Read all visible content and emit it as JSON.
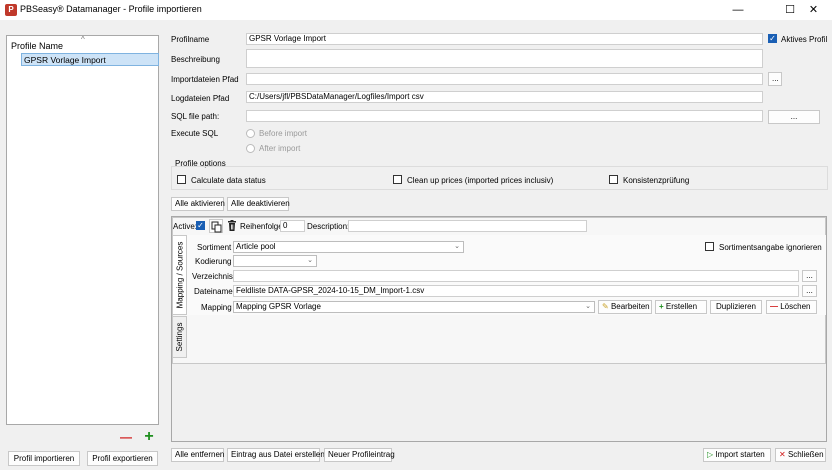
{
  "window": {
    "title": "PBSeasy® Datamanager - Profile importieren",
    "minimize": "—",
    "maximize": "☐",
    "close": "✕"
  },
  "sidebar": {
    "header": "Profile Name",
    "sort_indicator": "^",
    "items": [
      "GPSR Vorlage Import"
    ],
    "remove_symbol": "—",
    "add_symbol": "+"
  },
  "form": {
    "profilname_label": "Profilname",
    "profilname_value": "GPSR Vorlage Import",
    "aktives_profil_label": "Aktives Profil",
    "beschreibung_label": "Beschreibung",
    "beschreibung_value": "",
    "importdateien_label": "Importdateien Pfad",
    "importdateien_value": "",
    "logdateien_label": "Logdateien Pfad",
    "logdateien_value": "C:/Users/jfl/PBSDataManager/Logfiles/Import csv",
    "sql_label": "SQL file path:",
    "sql_value": "",
    "browse_label": "...",
    "execute_sql_label": "Execute SQL",
    "before_import": "Before import",
    "after_import": "After import"
  },
  "profile_options": {
    "title": "Profile options",
    "calculate": "Calculate data status",
    "cleanup": "Clean up prices (imported prices inclusiv)",
    "konsistenz": "Konsistenzprüfung"
  },
  "activate_buttons": {
    "all_on": "Alle aktivieren",
    "all_off": "Alle deaktivieren"
  },
  "entry": {
    "active_label": "Active:",
    "reihenfolge_label": "Reihenfolge",
    "reihenfolge_value": "0",
    "description_label": "Description:",
    "description_value": "",
    "tab_mapping": "Mapping / Sources",
    "tab_settings": "Settings",
    "sortiment_label": "Sortiment",
    "sortiment_value": "Article pool",
    "sortiment_ignore": "Sortimentsangabe ignorieren",
    "kodierung_label": "Kodierung",
    "kodierung_value": "",
    "verzeichnis_label": "Verzeichnis",
    "verzeichnis_value": "",
    "dateiname_label": "Dateiname",
    "dateiname_value": "Feldliste DATA-GPSR_2024-10-15_DM_Import-1.csv",
    "mapping_label": "Mapping",
    "mapping_value": "Mapping GPSR Vorlage",
    "bearbeiten": "Bearbeiten",
    "erstellen": "Erstellen",
    "duplizieren": "Duplizieren",
    "loeschen": "Löschen"
  },
  "bottom": {
    "profil_importieren": "Profil importieren",
    "profil_exportieren": "Profil exportieren",
    "alle_entfernen": "Alle entfernen",
    "eintrag_aus_datei": "Eintrag aus Datei erstellen",
    "neuer_profileintrag": "Neuer Profileintrag",
    "import_starten": "Import starten",
    "schliessen": "Schließen"
  },
  "colors": {
    "accent": "#1a5fb4",
    "selection_bg": "#cde3f7",
    "selection_border": "#7fb3e0",
    "remove_red": "#d11a1a",
    "add_green": "#1e8f1e"
  }
}
